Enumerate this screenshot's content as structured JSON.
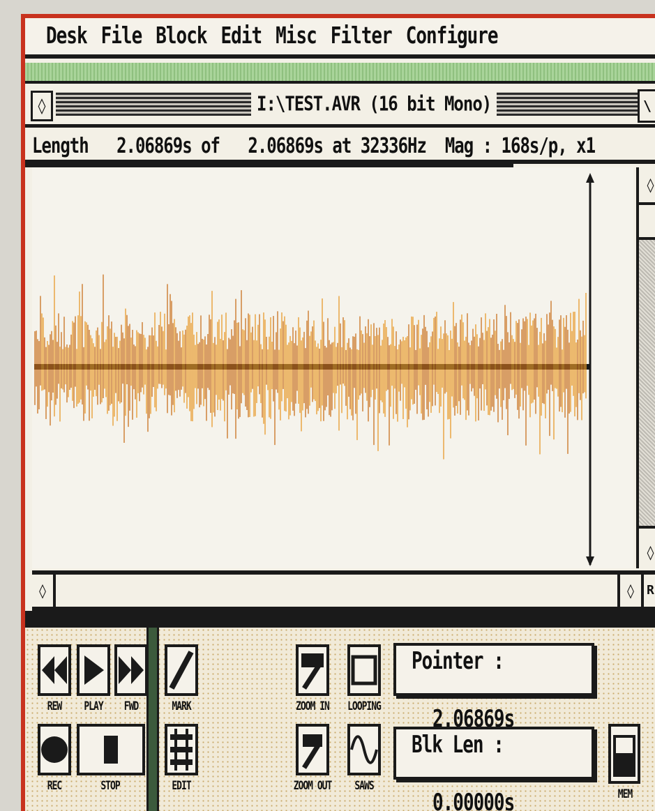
{
  "menu": [
    "Desk",
    "File",
    "Block",
    "Edit",
    "Misc",
    "Filter",
    "Configure"
  ],
  "window": {
    "closebox": "◊",
    "title": "I:\\TEST.AVR (16 bit Mono)",
    "fullbox": "\\"
  },
  "info": {
    "length_label": "Length",
    "length": "2.06869s",
    "of_label": "of",
    "total": "2.06869s",
    "at_label": "at",
    "rate": "32336Hz",
    "mag_label": "Mag :",
    "mag": "168s/p, x1"
  },
  "scroll": {
    "up": "◊",
    "down": "◊",
    "left": "◊",
    "right": "◊",
    "far": "R"
  },
  "transport": {
    "rew": "REW",
    "play": "PLAY",
    "ffwd": "FWD",
    "rec": "REC",
    "stop": "STOP"
  },
  "tools": {
    "mark": "MARK",
    "edit": "EDIT",
    "zoom_in": "ZOOM IN",
    "zoom_out": "ZOOM OUT",
    "loop": "LOOPING",
    "wave": "SAWS",
    "mem": "MEM"
  },
  "readouts": {
    "pointer_label": "Pointer :",
    "pointer_value": "2.06869s",
    "blklen_label": "Blk Len :",
    "blklen_value": "0.00000s"
  },
  "colors": {
    "waveform": "#e89a2a",
    "waveform_dark": "#c9701e",
    "border": "#c8321e",
    "green": "#a9d49a"
  }
}
